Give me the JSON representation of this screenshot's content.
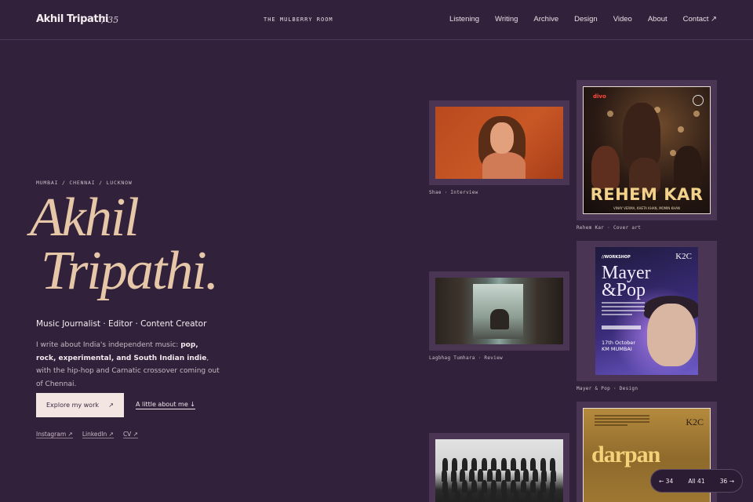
{
  "header": {
    "brand": "Akhil Tripathi",
    "brand_number": "/ 35",
    "site_title": "THE MULBERRY ROOM",
    "nav": [
      {
        "label": "Listening"
      },
      {
        "label": "Writing"
      },
      {
        "label": "Archive"
      },
      {
        "label": "Design"
      },
      {
        "label": "Video"
      },
      {
        "label": "About"
      },
      {
        "label": "Contact ↗"
      }
    ]
  },
  "hero": {
    "location": "MUMBAI / CHENNAI / LUCKNOW",
    "name_line1": "Akhil",
    "name_line2": "Tripathi.",
    "roles": "Music Journalist · Editor · Content Creator",
    "bio_pre": "I write about India's independent music: ",
    "bio_bold": "pop, rock, experimental, and South Indian indie",
    "bio_post": ", with the hip-hop and Carnatic crossover coming out of Chennai.",
    "explore_label": "Explore my work",
    "explore_arrow": "↗",
    "about_label": "A little about me ↓",
    "socials": [
      {
        "label": "Instagram ↗"
      },
      {
        "label": "LinkedIn ↗"
      },
      {
        "label": "CV ↗"
      }
    ]
  },
  "cards": {
    "shae": {
      "caption": "Shae · Interview"
    },
    "rehem": {
      "caption": "Rehem Kar · Cover art",
      "title": "REHEM KAR",
      "credits": "VINAY VERMA, KHETA KHAN, MOMIN KHAN",
      "label": "divo",
      "label_sub": "SINGLES"
    },
    "lagbhag": {
      "caption": "Lagbhag Tumhara · Review"
    },
    "mayer": {
      "caption": "Mayer & Pop · Design",
      "tag": "//WORKSHOP",
      "title_line1": "Mayer",
      "title_line2": "&Pop",
      "date_line1": "17th October",
      "date_line2": "KM MUMBAI",
      "logo": "K2C"
    },
    "darpan": {
      "title": "darpan",
      "logo": "K2C"
    },
    "choir": {}
  },
  "pager": {
    "prev": "← 34",
    "all": "All 41",
    "next": "36 →"
  }
}
